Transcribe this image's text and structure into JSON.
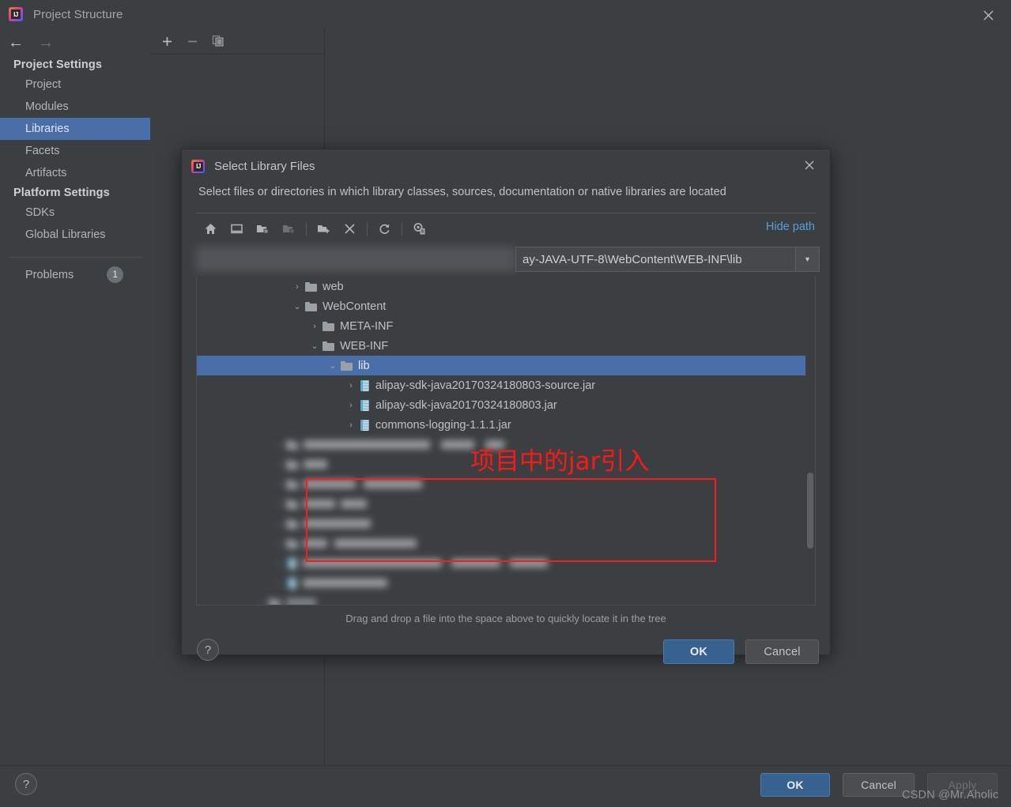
{
  "window": {
    "title": "Project Structure",
    "close_icon": "close-icon",
    "logo_text": "IJ"
  },
  "sidebar": {
    "back_icon": "←",
    "forward_icon": "→",
    "sections": [
      {
        "heading": "Project Settings",
        "items": [
          {
            "label": "Project",
            "selected": false
          },
          {
            "label": "Modules",
            "selected": false
          },
          {
            "label": "Libraries",
            "selected": true
          },
          {
            "label": "Facets",
            "selected": false
          },
          {
            "label": "Artifacts",
            "selected": false
          }
        ]
      },
      {
        "heading": "Platform Settings",
        "items": [
          {
            "label": "SDKs",
            "selected": false
          },
          {
            "label": "Global Libraries",
            "selected": false
          }
        ]
      }
    ],
    "problems": {
      "label": "Problems",
      "count": "1"
    }
  },
  "content": {
    "toolbar": [
      {
        "name": "add-button",
        "glyph": "+"
      },
      {
        "name": "remove-button",
        "glyph": "−"
      },
      {
        "name": "copy-button",
        "glyph": "copy-icon"
      }
    ]
  },
  "main_buttons": {
    "help_label": "?",
    "ok": "OK",
    "cancel": "Cancel",
    "apply": "Apply"
  },
  "watermark": "CSDN @Mr.Aholic",
  "dialog": {
    "title": "Select Library Files",
    "close_icon": "close-icon",
    "subtitle": "Select files or directories in which library classes, sources, documentation or native libraries are located",
    "toolbar": [
      {
        "name": "home-icon",
        "disabled": false
      },
      {
        "name": "desktop-icon",
        "disabled": false
      },
      {
        "name": "project-folder-icon",
        "disabled": false
      },
      {
        "name": "module-folder-icon",
        "disabled": true
      },
      {
        "name": "new-folder-icon",
        "disabled": false
      },
      {
        "name": "delete-icon",
        "disabled": false
      },
      {
        "name": "refresh-icon",
        "disabled": false
      },
      {
        "name": "show-hidden-icon",
        "disabled": false
      }
    ],
    "hide_path_label": "Hide path",
    "path_value": "ay-JAVA-UTF-8\\WebContent\\WEB-INF\\lib",
    "path_blurred_prefix": "                    ",
    "path_dropdown_icon": "▼",
    "tree": [
      {
        "label": "web",
        "indent": 2,
        "twisty": "›",
        "type": "folder",
        "selected": false
      },
      {
        "label": "WebContent",
        "indent": 2,
        "twisty": "⌄",
        "type": "folder",
        "selected": false
      },
      {
        "label": "META-INF",
        "indent": 3,
        "twisty": "›",
        "type": "folder",
        "selected": false
      },
      {
        "label": "WEB-INF",
        "indent": 3,
        "twisty": "⌄",
        "type": "folder",
        "selected": false
      },
      {
        "label": "lib",
        "indent": 4,
        "twisty": "⌄",
        "type": "folder",
        "selected": true
      },
      {
        "label": "alipay-sdk-java20170324180803-source.jar",
        "indent": 5,
        "twisty": "›",
        "type": "jar",
        "selected": false
      },
      {
        "label": "alipay-sdk-java20170324180803.jar",
        "indent": 5,
        "twisty": "›",
        "type": "jar",
        "selected": false
      },
      {
        "label": "commons-logging-1.1.1.jar",
        "indent": 5,
        "twisty": "›",
        "type": "jar",
        "selected": false
      }
    ],
    "blurred_rows": [
      {
        "indent": 2,
        "type": "folder",
        "widths": [
          160,
          42,
          24
        ]
      },
      {
        "indent": 2,
        "type": "folder",
        "widths": [
          30
        ]
      },
      {
        "indent": 2,
        "type": "folder",
        "widths": [
          66,
          74
        ]
      },
      {
        "indent": 2,
        "type": "folder",
        "widths": [
          40,
          33
        ]
      },
      {
        "indent": 2,
        "type": "folder",
        "widths": [
          85
        ]
      },
      {
        "indent": 2,
        "type": "folder",
        "widths": [
          30,
          104
        ]
      },
      {
        "indent": 2,
        "type": "jar",
        "widths": [
          176,
          62,
          48
        ]
      },
      {
        "indent": 2,
        "type": "jar",
        "widths": [
          107
        ]
      },
      {
        "indent": 1,
        "type": "folder",
        "widths": [
          38
        ]
      }
    ],
    "annotation": {
      "text": "项目中的jar引入",
      "color": "#ff1717"
    },
    "hint": "Drag and drop a file into the space above to quickly locate it in the tree",
    "help_label": "?",
    "ok": "OK",
    "cancel": "Cancel"
  },
  "colors": {
    "background": "#3c3f41",
    "selection_blue": "#4a6fa8",
    "primary_button": "#37618e",
    "link_blue": "#5a9ed8",
    "annotation_red": "#ff1717"
  }
}
